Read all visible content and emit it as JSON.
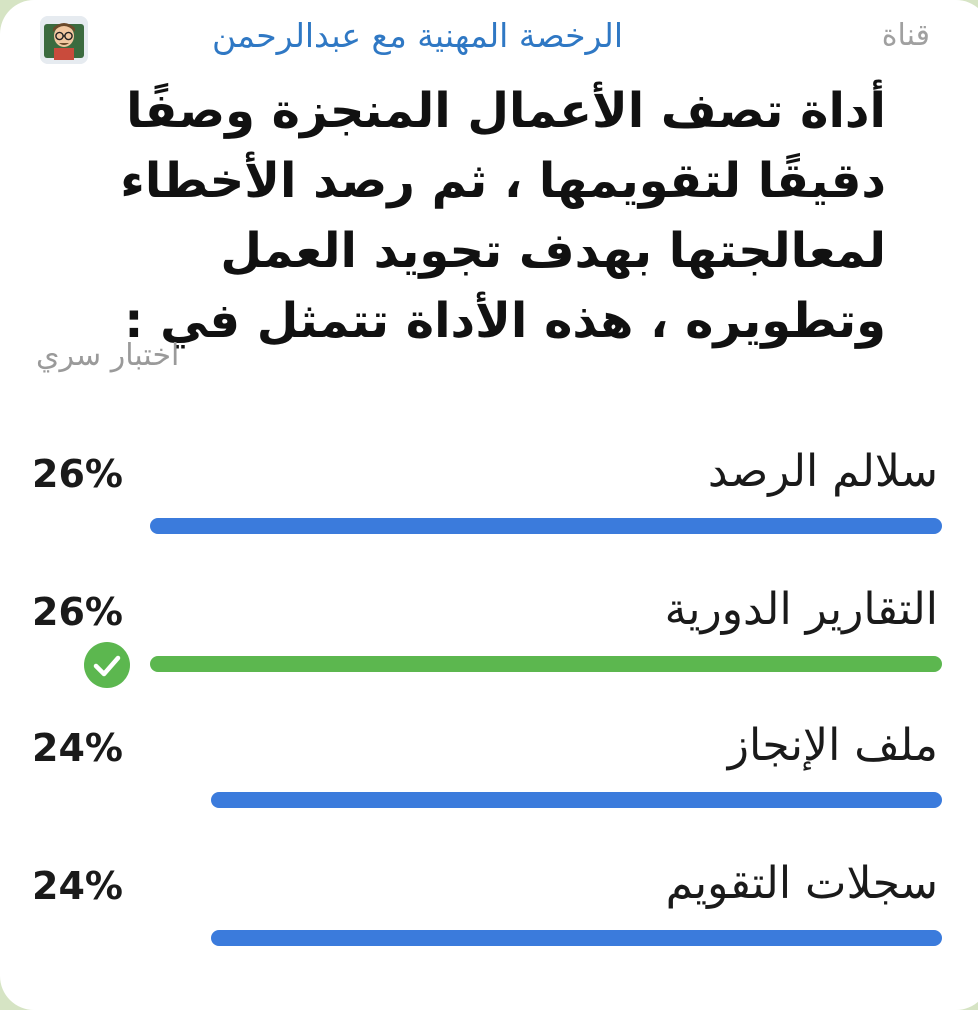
{
  "header": {
    "channel_tag": "قناة",
    "channel_name": "الرخصة المهنية مع عبدالرحمن",
    "avatar_icon": "teacher-emoji-icon"
  },
  "poll": {
    "question": "أداة تصف الأعمال المنجزة وصفًا دقيقًا لتقويمها ، ثم رصد الأخطاء لمعالجتها بهدف تجويد العمل وتطويره ، هذه الأداة تتمثل في :",
    "type": "اختبار سري",
    "options": [
      {
        "label": "سلالم الرصد",
        "percent_text": "26%",
        "value": 0.26,
        "bar_color": "#3b7bdc",
        "correct": false
      },
      {
        "label": "التقارير الدورية",
        "percent_text": "26%",
        "value": 0.26,
        "bar_color": "#5cb74f",
        "correct": true
      },
      {
        "label": "ملف الإنجاز",
        "percent_text": "24%",
        "value": 0.24,
        "bar_color": "#3b7bdc",
        "correct": false
      },
      {
        "label": "سجلات التقويم",
        "percent_text": "24%",
        "value": 0.24,
        "bar_color": "#3b7bdc",
        "correct": false
      }
    ],
    "correct_icon": "checkmark-circle-icon",
    "correct_color": "#5cb74f"
  }
}
